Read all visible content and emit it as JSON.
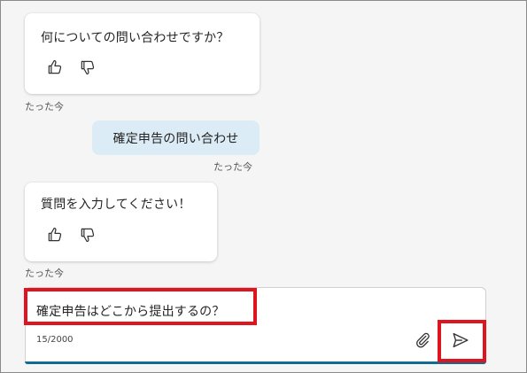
{
  "messages": [
    {
      "role": "bot",
      "text": "何についての問い合わせですか？",
      "timestamp": "たった今"
    },
    {
      "role": "user",
      "text": "確定申告の問い合わせ",
      "timestamp": "たった今"
    },
    {
      "role": "bot",
      "text": "質問を入力してください！",
      "timestamp": "たった今"
    }
  ],
  "composer": {
    "value": "確定申告はどこから提出するの？",
    "counter": "15/2000"
  },
  "icons": {
    "like": "thumbs-up-icon",
    "dislike": "thumbs-down-icon",
    "attach": "paperclip-icon",
    "send": "send-icon"
  },
  "colors": {
    "user_bubble": "#dcecf6",
    "highlight": "#e0141e",
    "composer_accent": "#0f6b93"
  }
}
